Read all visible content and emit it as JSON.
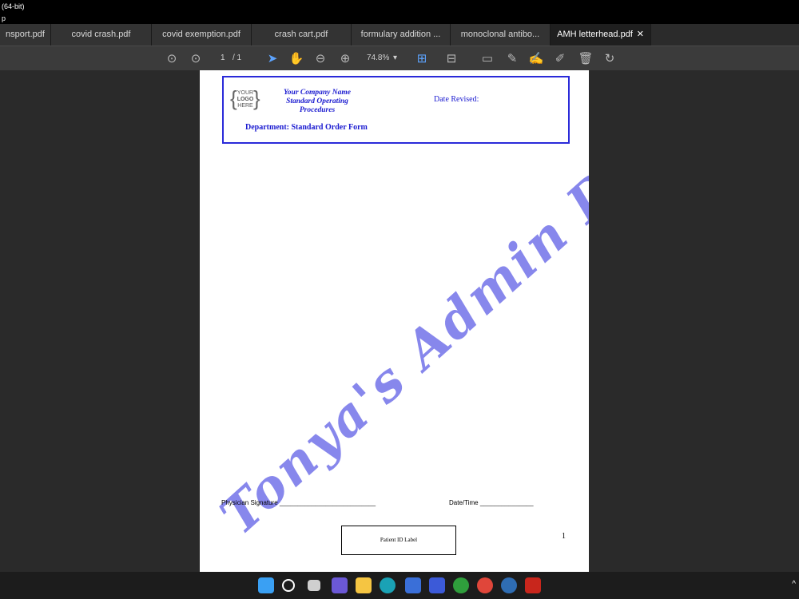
{
  "window": {
    "title": "(64-bit)",
    "menu": "p"
  },
  "tabs": [
    {
      "label": "nsport.pdf",
      "active": false
    },
    {
      "label": "covid crash.pdf",
      "active": false
    },
    {
      "label": "covid exemption.pdf",
      "active": false
    },
    {
      "label": "crash cart.pdf",
      "active": false
    },
    {
      "label": "formulary addition ...",
      "active": false
    },
    {
      "label": "monoclonal antibo...",
      "active": false
    },
    {
      "label": "AMH letterhead.pdf",
      "active": true
    }
  ],
  "toolbar": {
    "page_current": "1",
    "page_total": "/ 1",
    "zoom": "74.8%",
    "icons": [
      "prev-page-icon",
      "next-page-icon",
      "select-arrow-icon",
      "hand-tool-icon",
      "zoom-out-icon",
      "zoom-in-icon",
      "fit-page-icon",
      "read-mode-icon",
      "comment-icon",
      "highlight-icon",
      "sign-icon",
      "edit-icon",
      "delete-icon",
      "rotate-icon"
    ]
  },
  "document": {
    "logo_lines": [
      "YOUR",
      "LOGO",
      "HERE"
    ],
    "company_lines": [
      "Your Company Name",
      "Standard Operating",
      "Procedures"
    ],
    "date_revised": "Date Revised:",
    "department": "Department: Standard Order Form",
    "watermark": "Tonya's Admin Designs",
    "physician_signature": "Physician Signature ___________________________",
    "date_time": "Date/Time _______________",
    "patient_id_label": "Patient ID Label",
    "page_number": "1"
  },
  "colors": {
    "accent_blue": "#2a2ad9",
    "watermark": "#7b7bea",
    "toolbar_active": "#5da4ff"
  }
}
